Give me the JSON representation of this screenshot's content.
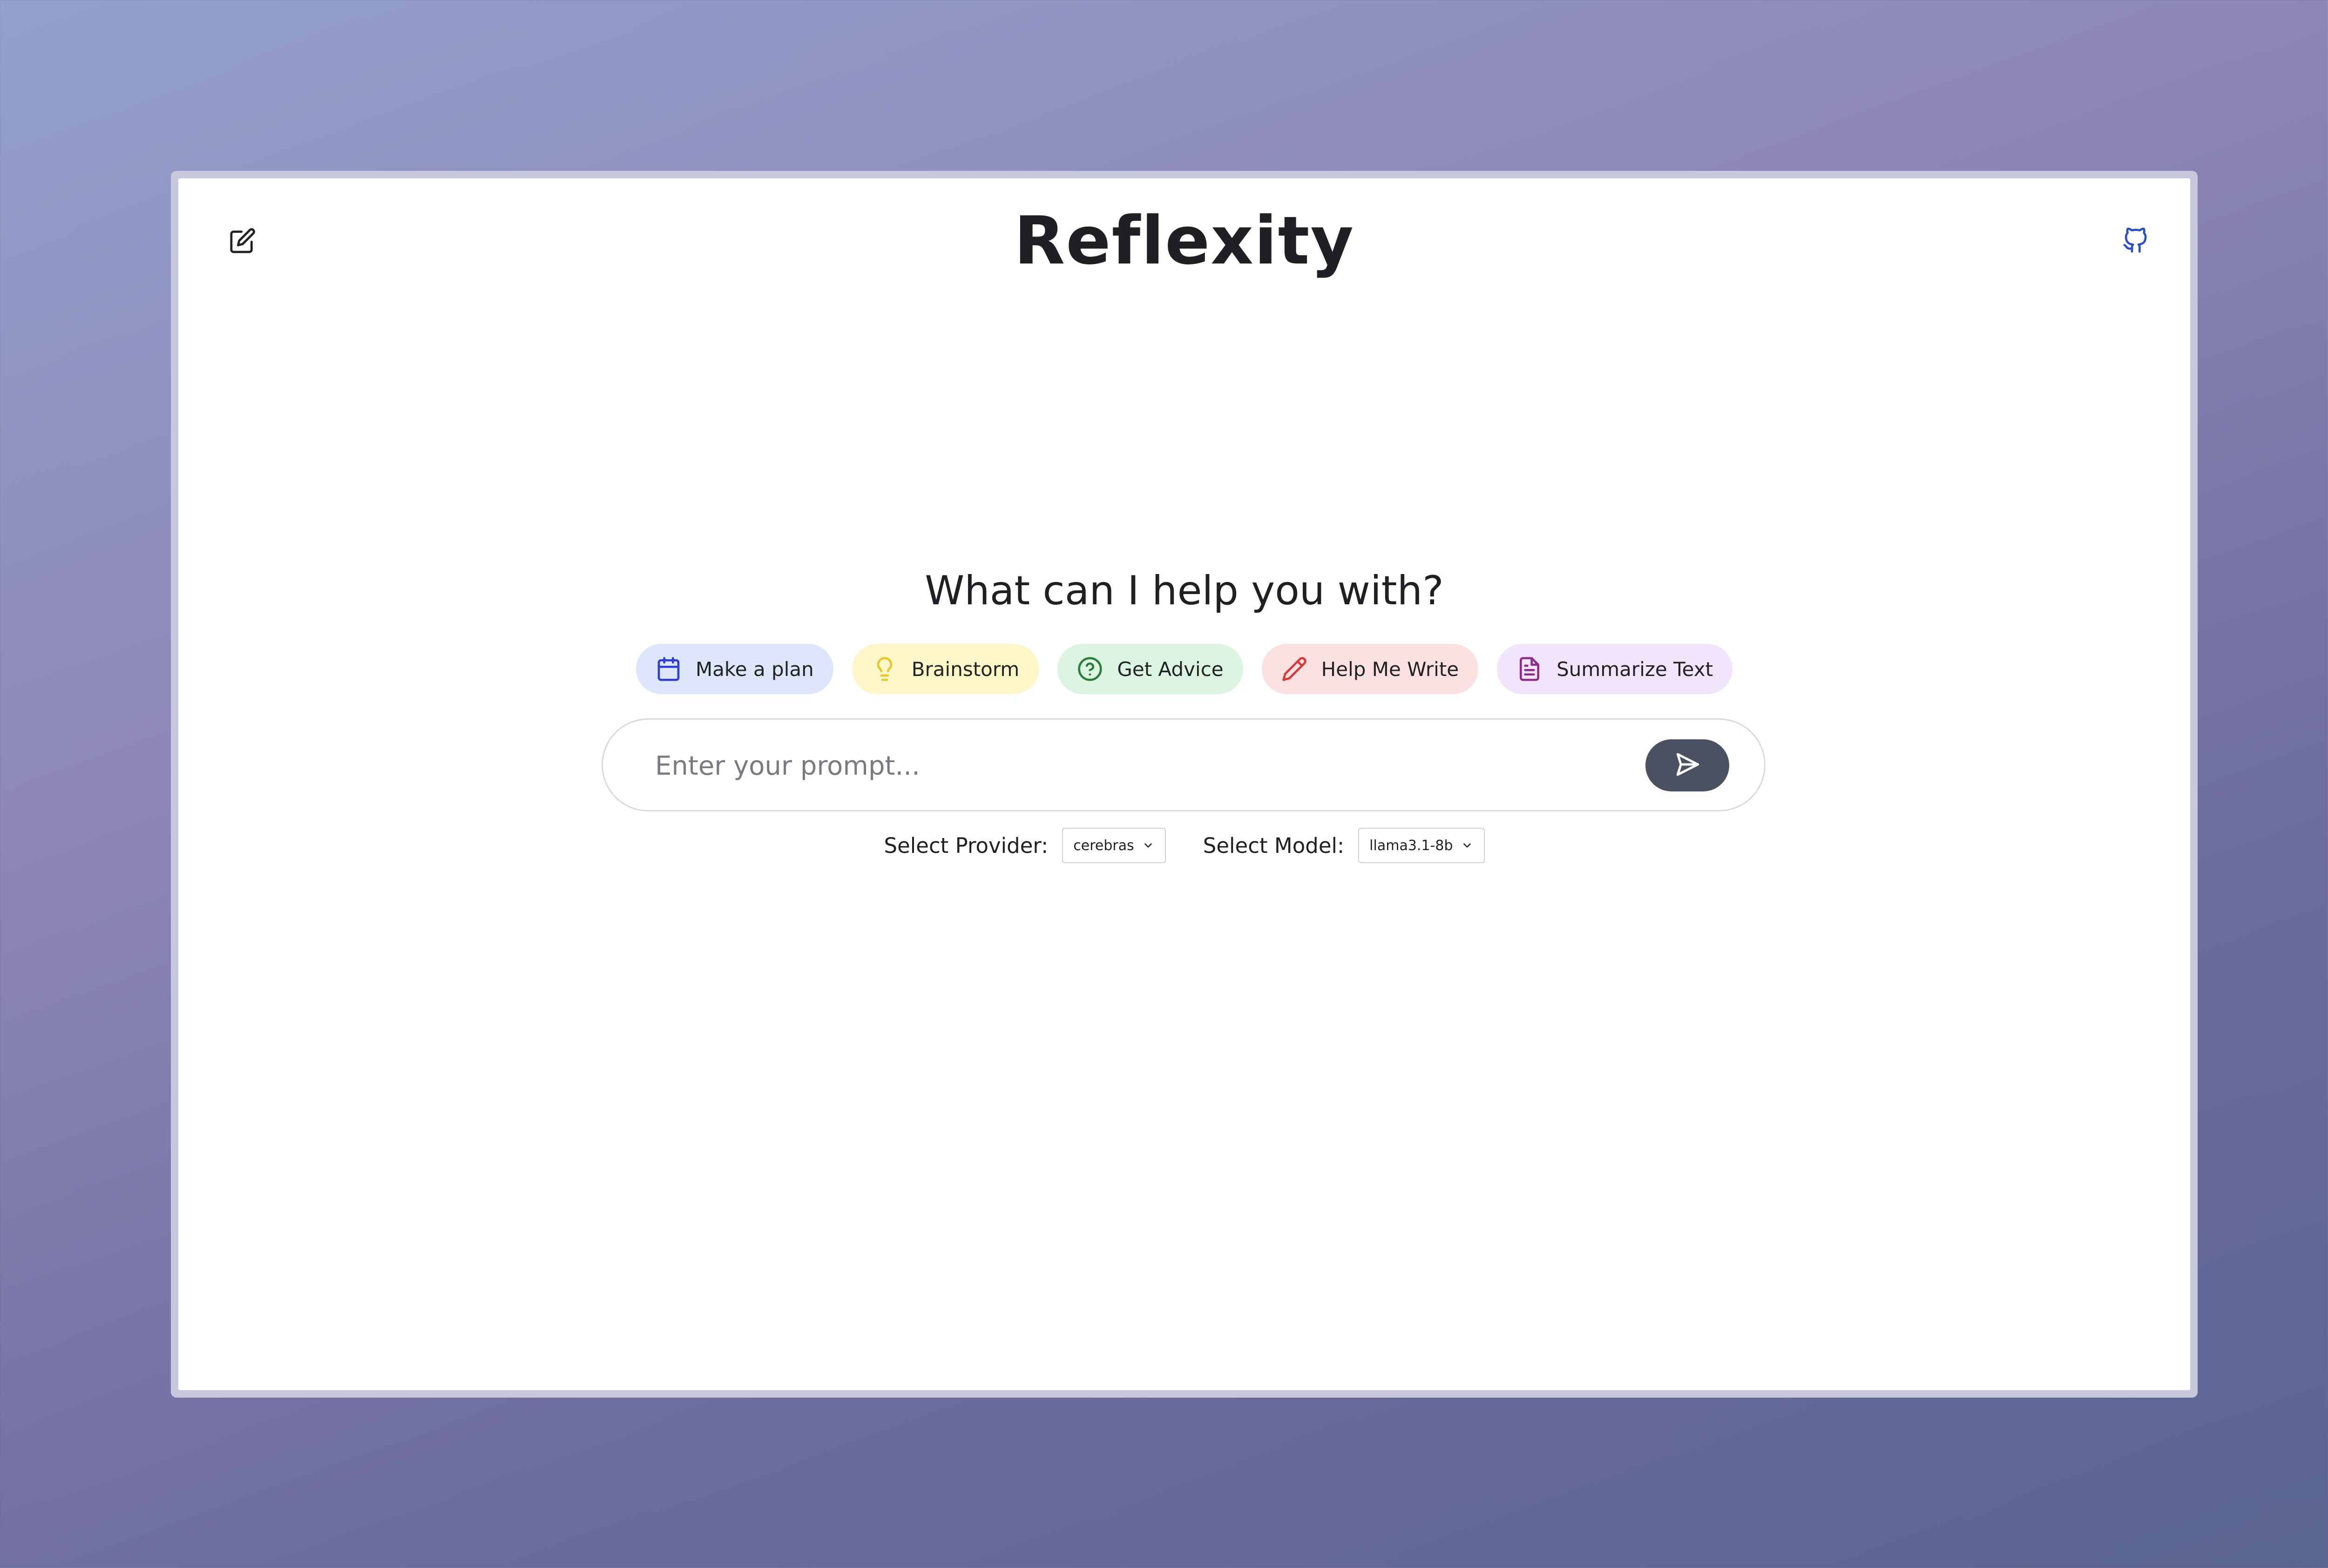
{
  "app": {
    "title": "Reflexity"
  },
  "main": {
    "heading": "What can I help you with?",
    "chips": [
      {
        "label": "Make a plan",
        "icon": "calendar-icon",
        "color": "#2f3fcf"
      },
      {
        "label": "Brainstorm",
        "icon": "lightbulb-icon",
        "color": "#e7c62a"
      },
      {
        "label": "Get Advice",
        "icon": "help-circle-icon",
        "color": "#2e7d3c"
      },
      {
        "label": "Help Me Write",
        "icon": "pencil-icon",
        "color": "#d83a3a"
      },
      {
        "label": "Summarize Text",
        "icon": "file-text-icon",
        "color": "#8e2d8e"
      }
    ],
    "prompt": {
      "placeholder": "Enter your prompt...",
      "value": ""
    }
  },
  "selectors": {
    "provider_label": "Select Provider:",
    "provider_value": "cerebras",
    "model_label": "Select Model:",
    "model_value": "llama3.1-8b"
  },
  "header": {
    "left_icon": "edit-icon",
    "right_icon": "github-icon",
    "github_color": "#2a4fc9"
  }
}
